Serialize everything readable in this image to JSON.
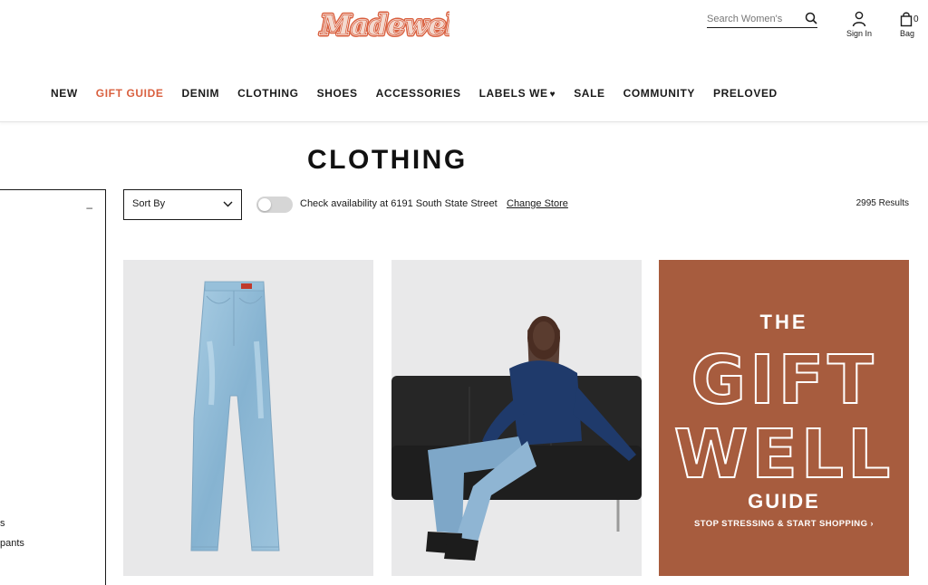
{
  "brand": {
    "logo_text": "Madewell"
  },
  "search": {
    "placeholder": "Search Women's"
  },
  "utility": {
    "signin_label": "Sign In",
    "bag_label": "Bag",
    "bag_count": "0"
  },
  "nav": {
    "items": [
      {
        "label": "NEW"
      },
      {
        "label": "GIFT GUIDE"
      },
      {
        "label": "DENIM"
      },
      {
        "label": "CLOTHING"
      },
      {
        "label": "SHOES"
      },
      {
        "label": "ACCESSORIES"
      },
      {
        "label": "LABELS WE"
      },
      {
        "label": "SALE"
      },
      {
        "label": "COMMUNITY"
      },
      {
        "label": "PRELOVED"
      }
    ]
  },
  "page": {
    "title": "CLOTHING"
  },
  "sidebar": {
    "collapse_symbol": "–",
    "visible_fragments": [
      "s",
      "pants"
    ]
  },
  "toolbar": {
    "sort_label": "Sort By",
    "availability_text": "Check availability at 6191 South State Street",
    "change_store_label": "Change Store",
    "results_text": "2995 Results",
    "store_toggle_on": false
  },
  "promo": {
    "the": "THE",
    "gift": "GIFT",
    "well": "WELL",
    "guide": "GUIDE",
    "cta": "STOP STRESSING & START SHOPPING ›"
  },
  "colors": {
    "accent": "#d9603f",
    "promo_bg": "#a75c3e",
    "text": "#1a1a1a"
  },
  "icons": {
    "search": "search-icon",
    "account": "user-icon",
    "bag": "bag-icon",
    "sort_chevron": "chevron-down-icon",
    "labels_heart": "heart-icon"
  }
}
